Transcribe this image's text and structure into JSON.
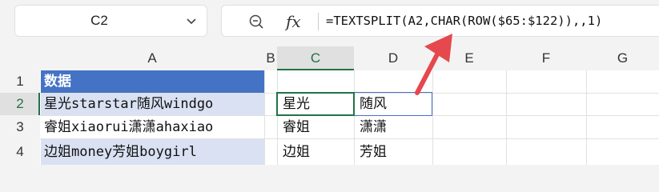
{
  "name_box": {
    "value": "C2"
  },
  "formula_bar": {
    "fx": "fx",
    "formula": "=TEXTSPLIT(A2,CHAR(ROW($65:$122)),,1)"
  },
  "columns": [
    "A",
    "B",
    "C",
    "D",
    "E",
    "F",
    "G"
  ],
  "rows": [
    "1",
    "2",
    "3",
    "4"
  ],
  "cells": {
    "A1": "数据",
    "A2": "星光starstar随风windgo",
    "A3": "睿姐xiaorui潇潇ahaxiao",
    "A4": "边姐money芳姐boygirl",
    "C2": "星光",
    "D2": "随风",
    "C3": "睿姐",
    "D3": "潇潇",
    "C4": "边姐",
    "D4": "芳姐"
  },
  "colors": {
    "header_fill": "#4472c4",
    "band_fill": "#d9e1f2",
    "selection": "#217346",
    "arrow": "#e5484d"
  }
}
